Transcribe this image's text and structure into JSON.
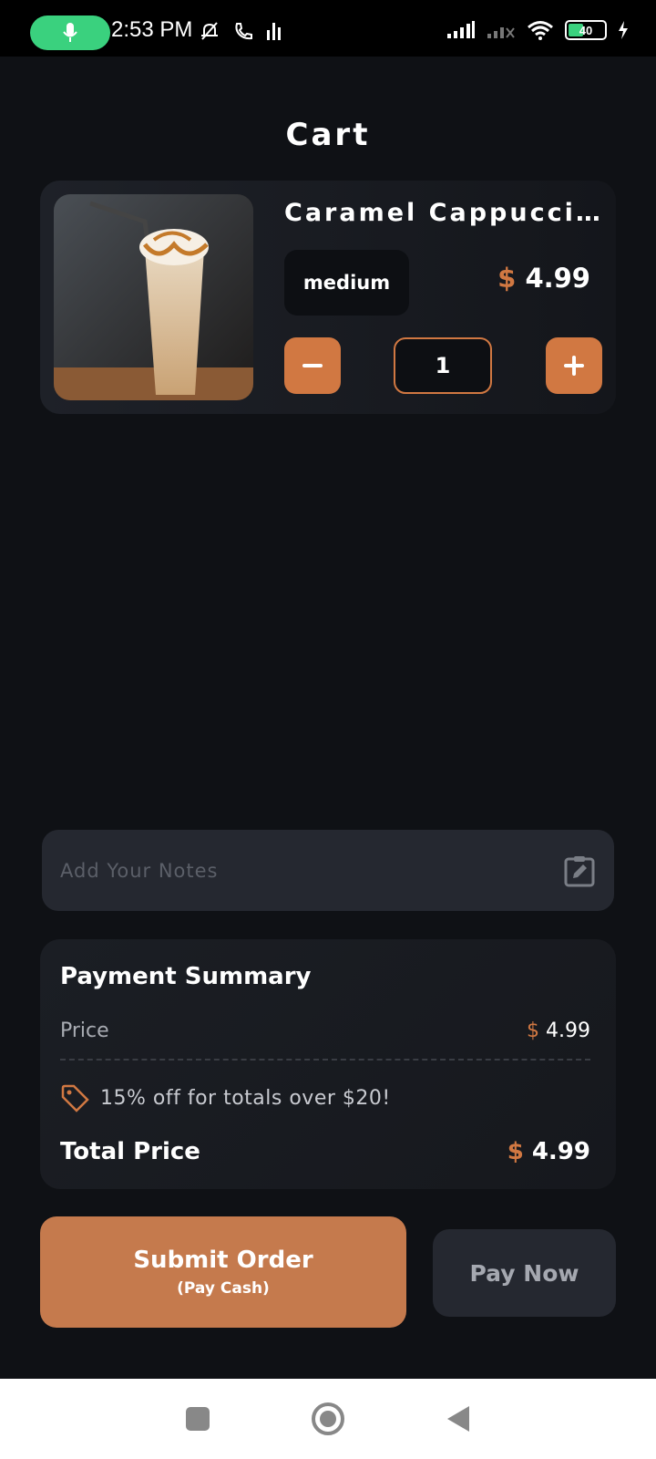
{
  "status_bar": {
    "time": "2:53 PM",
    "battery": "40",
    "mic_color": "#3ad17e"
  },
  "header": {
    "title": "Cart"
  },
  "cart_item": {
    "name": "Caramel Cappucci…",
    "size": "medium",
    "currency": "$",
    "price": "4.99",
    "quantity": "1",
    "image_icon": "iced-caramel-drink-photo"
  },
  "notes": {
    "placeholder": "Add Your Notes",
    "value": ""
  },
  "summary": {
    "title": "Payment Summary",
    "price_label": "Price",
    "price_currency": "$",
    "price_value": "4.99",
    "promo_text": "15% off for totals over $20!",
    "total_label": "Total Price",
    "total_currency": "$",
    "total_value": "4.99"
  },
  "actions": {
    "submit_label": "Submit Order",
    "submit_sublabel": "(Pay Cash)",
    "pay_now_label": "Pay Now"
  },
  "colors": {
    "accent": "#d17842",
    "background": "#0f1115",
    "card": "#1e2128"
  }
}
